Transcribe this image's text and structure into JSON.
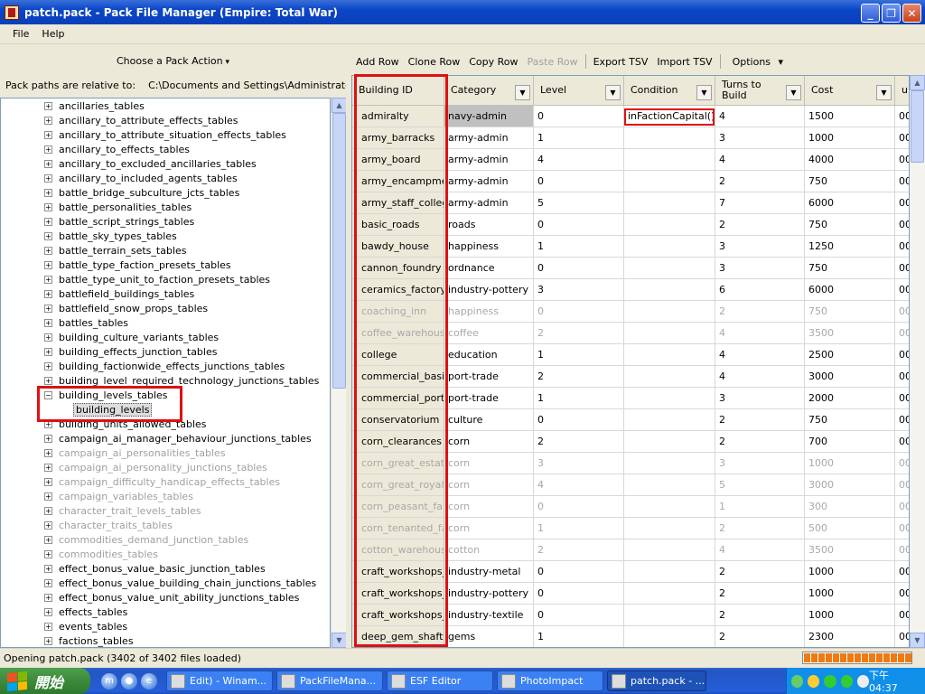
{
  "window": {
    "title": "patch.pack - Pack File Manager (Empire: Total War)"
  },
  "menu": [
    "File",
    "Help"
  ],
  "left": {
    "pack_action": "Choose a Pack Action",
    "path_label": "Pack paths are relative to:",
    "path_value": "C:\\Documents and Settings\\Administrator\\桌面",
    "tree_items": [
      {
        "label": "ancillaries_tables",
        "grey": false
      },
      {
        "label": "ancillary_to_attribute_effects_tables",
        "grey": false
      },
      {
        "label": "ancillary_to_attribute_situation_effects_tables",
        "grey": false
      },
      {
        "label": "ancillary_to_effects_tables",
        "grey": false
      },
      {
        "label": "ancillary_to_excluded_ancillaries_tables",
        "grey": false
      },
      {
        "label": "ancillary_to_included_agents_tables",
        "grey": false
      },
      {
        "label": "battle_bridge_subculture_jcts_tables",
        "grey": false
      },
      {
        "label": "battle_personalities_tables",
        "grey": false
      },
      {
        "label": "battle_script_strings_tables",
        "grey": false
      },
      {
        "label": "battle_sky_types_tables",
        "grey": false
      },
      {
        "label": "battle_terrain_sets_tables",
        "grey": false
      },
      {
        "label": "battle_type_faction_presets_tables",
        "grey": false
      },
      {
        "label": "battle_type_unit_to_faction_presets_tables",
        "grey": false
      },
      {
        "label": "battlefield_buildings_tables",
        "grey": false
      },
      {
        "label": "battlefield_snow_props_tables",
        "grey": false
      },
      {
        "label": "battles_tables",
        "grey": false
      },
      {
        "label": "building_culture_variants_tables",
        "grey": false
      },
      {
        "label": "building_effects_junction_tables",
        "grey": false
      },
      {
        "label": "building_factionwide_effects_junctions_tables",
        "grey": false
      },
      {
        "label": "building_level_required_technology_junctions_tables",
        "grey": false
      },
      {
        "label": "building_levels_tables",
        "grey": false,
        "expanded": true,
        "child": "building_levels"
      },
      {
        "label": "building_units_allowed_tables",
        "grey": false
      },
      {
        "label": "campaign_ai_manager_behaviour_junctions_tables",
        "grey": false
      },
      {
        "label": "campaign_ai_personalities_tables",
        "grey": true
      },
      {
        "label": "campaign_ai_personality_junctions_tables",
        "grey": true
      },
      {
        "label": "campaign_difficulty_handicap_effects_tables",
        "grey": true
      },
      {
        "label": "campaign_variables_tables",
        "grey": true
      },
      {
        "label": "character_trait_levels_tables",
        "grey": true
      },
      {
        "label": "character_traits_tables",
        "grey": true
      },
      {
        "label": "commodities_demand_junction_tables",
        "grey": true
      },
      {
        "label": "commodities_tables",
        "grey": true
      },
      {
        "label": "effect_bonus_value_basic_junction_tables",
        "grey": false
      },
      {
        "label": "effect_bonus_value_building_chain_junctions_tables",
        "grey": false
      },
      {
        "label": "effect_bonus_value_unit_ability_junctions_tables",
        "grey": false
      },
      {
        "label": "effects_tables",
        "grey": false
      },
      {
        "label": "events_tables",
        "grey": false
      },
      {
        "label": "factions_tables",
        "grey": false
      }
    ]
  },
  "toolbar": {
    "add_row": "Add Row",
    "clone_row": "Clone Row",
    "copy_row": "Copy Row",
    "paste_row": "Paste Row",
    "export_tsv": "Export TSV",
    "import_tsv": "Import TSV",
    "options": "Options"
  },
  "grid": {
    "columns": [
      "Building ID",
      "Category",
      "Level",
      "Condition",
      "Turns to Build",
      "Cost",
      "u"
    ],
    "rows": [
      {
        "id": "admiralty",
        "category": "navy-admin",
        "level": "0",
        "condition": "inFactionCapital()",
        "turns": "4",
        "cost": "1500",
        "u": "00",
        "grey": false
      },
      {
        "id": "army_barracks",
        "category": "army-admin",
        "level": "1",
        "condition": "",
        "turns": "3",
        "cost": "1000",
        "u": "00",
        "grey": false
      },
      {
        "id": "army_board",
        "category": "army-admin",
        "level": "4",
        "condition": "",
        "turns": "4",
        "cost": "4000",
        "u": "00",
        "grey": false
      },
      {
        "id": "army_encampmen",
        "category": "army-admin",
        "level": "0",
        "condition": "",
        "turns": "2",
        "cost": "750",
        "u": "00",
        "grey": false
      },
      {
        "id": "army_staff_colleg",
        "category": "army-admin",
        "level": "5",
        "condition": "",
        "turns": "7",
        "cost": "6000",
        "u": "00",
        "grey": false
      },
      {
        "id": "basic_roads",
        "category": "roads",
        "level": "0",
        "condition": "",
        "turns": "2",
        "cost": "750",
        "u": "00",
        "grey": false
      },
      {
        "id": "bawdy_house",
        "category": "happiness",
        "level": "1",
        "condition": "",
        "turns": "3",
        "cost": "1250",
        "u": "00",
        "grey": false
      },
      {
        "id": "cannon_foundry",
        "category": "ordnance",
        "level": "0",
        "condition": "",
        "turns": "3",
        "cost": "750",
        "u": "00",
        "grey": false
      },
      {
        "id": "ceramics_factory",
        "category": "industry-pottery",
        "level": "3",
        "condition": "",
        "turns": "6",
        "cost": "6000",
        "u": "00",
        "grey": false
      },
      {
        "id": "coaching_inn",
        "category": "happiness",
        "level": "0",
        "condition": "",
        "turns": "2",
        "cost": "750",
        "u": "00",
        "grey": true
      },
      {
        "id": "coffee_warehouse",
        "category": "coffee",
        "level": "2",
        "condition": "",
        "turns": "4",
        "cost": "3500",
        "u": "00",
        "grey": true
      },
      {
        "id": "college",
        "category": "education",
        "level": "1",
        "condition": "",
        "turns": "4",
        "cost": "2500",
        "u": "00",
        "grey": false
      },
      {
        "id": "commercial_basin",
        "category": "port-trade",
        "level": "2",
        "condition": "",
        "turns": "4",
        "cost": "3000",
        "u": "00",
        "grey": false
      },
      {
        "id": "commercial_port",
        "category": "port-trade",
        "level": "1",
        "condition": "",
        "turns": "3",
        "cost": "2000",
        "u": "00",
        "grey": false
      },
      {
        "id": "conservatorium",
        "category": "culture",
        "level": "0",
        "condition": "",
        "turns": "2",
        "cost": "750",
        "u": "00",
        "grey": false
      },
      {
        "id": "corn_clearances",
        "category": "corn",
        "level": "2",
        "condition": "",
        "turns": "2",
        "cost": "700",
        "u": "00",
        "grey": false
      },
      {
        "id": "corn_great_estate",
        "category": "corn",
        "level": "3",
        "condition": "",
        "turns": "3",
        "cost": "1000",
        "u": "00",
        "grey": true
      },
      {
        "id": "corn_great_royal_",
        "category": "corn",
        "level": "4",
        "condition": "",
        "turns": "5",
        "cost": "3000",
        "u": "00",
        "grey": true
      },
      {
        "id": "corn_peasant_far",
        "category": "corn",
        "level": "0",
        "condition": "",
        "turns": "1",
        "cost": "300",
        "u": "00",
        "grey": true
      },
      {
        "id": "corn_tenanted_far",
        "category": "corn",
        "level": "1",
        "condition": "",
        "turns": "2",
        "cost": "500",
        "u": "00",
        "grey": true
      },
      {
        "id": "cotton_warehouse",
        "category": "cotton",
        "level": "2",
        "condition": "",
        "turns": "4",
        "cost": "3500",
        "u": "00",
        "grey": true
      },
      {
        "id": "craft_workshops_",
        "category": "industry-metal",
        "level": "0",
        "condition": "",
        "turns": "2",
        "cost": "1000",
        "u": "00",
        "grey": false
      },
      {
        "id": "craft_workshops_",
        "category": "industry-pottery",
        "level": "0",
        "condition": "",
        "turns": "2",
        "cost": "1000",
        "u": "00",
        "grey": false
      },
      {
        "id": "craft_workshops_t",
        "category": "industry-textile",
        "level": "0",
        "condition": "",
        "turns": "2",
        "cost": "1000",
        "u": "00",
        "grey": false
      },
      {
        "id": "deep_gem_shaft",
        "category": "gems",
        "level": "1",
        "condition": "",
        "turns": "2",
        "cost": "2300",
        "u": "00",
        "grey": false
      }
    ]
  },
  "status": {
    "text": "Opening patch.pack (3402 of 3402 files loaded)",
    "progress": 1.0
  },
  "taskbar": {
    "start": "開始",
    "buttons": [
      {
        "label": "Edit) - Winam..."
      },
      {
        "label": "PackFileMana..."
      },
      {
        "label": "ESF Editor"
      },
      {
        "label": "PhotoImpact"
      },
      {
        "label": "patch.pack - ...",
        "active": true
      }
    ],
    "clock": "下午 04:37"
  },
  "colors": {
    "highlight": "#e01010",
    "title_blue": "#0a46c8",
    "taskbar_blue": "#245ed9",
    "start_green": "#3c8a3c",
    "progress_orange": "#f07a10"
  }
}
